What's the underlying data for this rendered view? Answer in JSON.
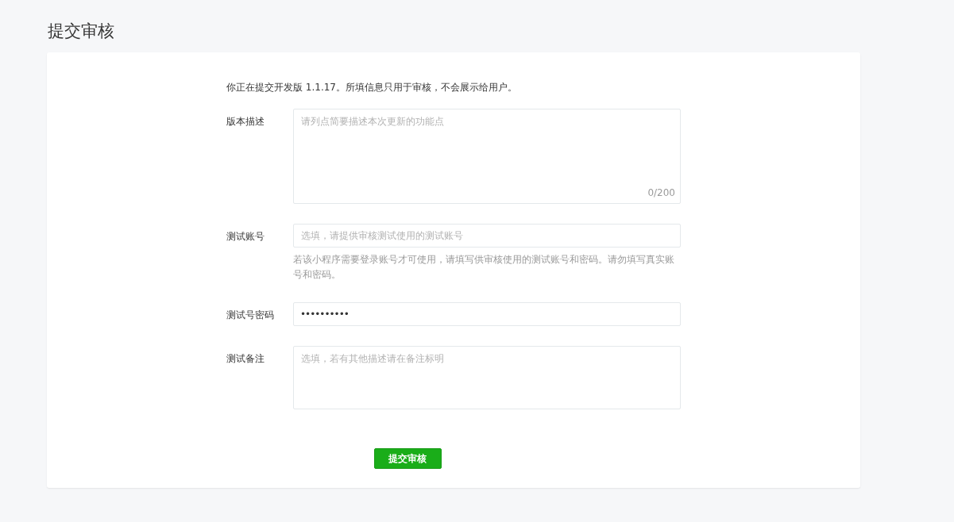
{
  "page_title": "提交审核",
  "intro": "你正在提交开发版 1.1.17。所填信息只用于审核，不会展示给用户。",
  "fields": [
    {
      "kind": "textarea",
      "label": "版本描述",
      "placeholder": "请列点简要描述本次更新的功能点",
      "counter": "0/200"
    },
    {
      "kind": "input",
      "label": "测试账号",
      "placeholder": "选填，请提供审核测试使用的测试账号",
      "hint": "若该小程序需要登录账号才可使用，请填写供审核使用的测试账号和密码。请勿填写真实账号和密码。"
    },
    {
      "kind": "password",
      "label": "测试号密码",
      "value": "••••••••••"
    },
    {
      "kind": "textarea",
      "label": "测试备注",
      "placeholder": "选填，若有其他描述请在备注标明"
    }
  ],
  "submit_button": "提交审核"
}
